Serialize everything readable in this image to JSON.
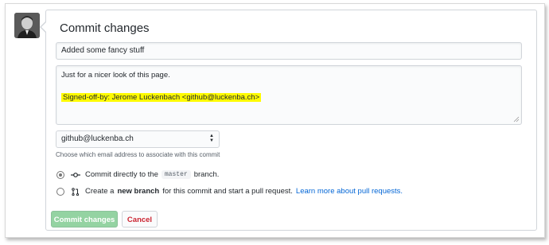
{
  "form": {
    "heading": "Commit changes",
    "summary_value": "Added some fancy stuff",
    "description_line1": "Just for a nicer look of this page.",
    "description_signoff": "Signed-off-by: Jerome Luckenbach <github@luckenba.ch>",
    "email_selected": "github@luckenba.ch",
    "email_help": "Choose which email address to associate with this commit"
  },
  "options": {
    "direct": {
      "prefix": "Commit directly to the",
      "branch": "master",
      "suffix": "branch."
    },
    "new_branch": {
      "prefix": "Create a",
      "bold": "new branch",
      "middle": "for this commit and start a pull request.",
      "link": "Learn more about pull requests."
    }
  },
  "buttons": {
    "commit": "Commit changes",
    "cancel": "Cancel"
  },
  "icons": {
    "avatar": "user-avatar",
    "commit": "git-commit-icon",
    "pr": "git-pull-request-icon"
  },
  "colors": {
    "commit_button": "#94d3a2",
    "cancel_text": "#cb2431",
    "link": "#0366d6",
    "signoff_highlight": "#fffb00"
  }
}
